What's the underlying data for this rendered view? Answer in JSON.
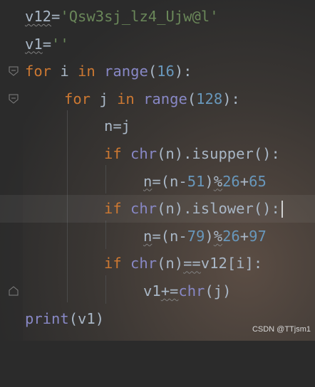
{
  "code": {
    "l1": {
      "var": "v12",
      "op": "=",
      "str": "'Qsw3sj_lz4_Ujw@l'"
    },
    "l2": {
      "var": "v1",
      "op": "=",
      "str": "''"
    },
    "l3": {
      "kw1": "for",
      "var": " i ",
      "kw2": "in",
      "sp": " ",
      "fn": "range",
      "p1": "(",
      "num": "16",
      "p2": "):"
    },
    "l4": {
      "kw1": "for",
      "var": " j ",
      "kw2": "in",
      "sp": " ",
      "fn": "range",
      "p1": "(",
      "num": "128",
      "p2": "):"
    },
    "l5": {
      "text": "n=j"
    },
    "l6": {
      "kw": "if",
      "sp": " ",
      "fn": "chr",
      "rest": "(n).isupper():"
    },
    "l7": {
      "a": "n",
      "b": "=(n-",
      "num1": "51",
      "c": ")",
      "d": "%",
      "num2": "26",
      "e": "+",
      "num3": "65"
    },
    "l8": {
      "kw": "if",
      "sp": " ",
      "fn": "chr",
      "rest": "(n).islower():"
    },
    "l9": {
      "a": "n",
      "b": "=(n-",
      "num1": "79",
      "c": ")",
      "d": "%",
      "num2": "26",
      "e": "+",
      "num3": "97"
    },
    "l10": {
      "kw": "if",
      "sp": " ",
      "fn": "chr",
      "a": "(n)",
      "b": "==",
      "c": "v12[i]:"
    },
    "l11": {
      "a": "v1",
      "b": "+=",
      "fn": "chr",
      "c": "(j)"
    },
    "l12": {
      "fn": "print",
      "rest": "(v1)"
    }
  },
  "watermark": "CSDN @TTjsm1",
  "icons": {
    "fold_open": "fold-open-icon",
    "fold_end": "fold-end-icon"
  },
  "colors": {
    "keyword": "#cc7832",
    "builtin": "#8888c6",
    "number": "#6897bb",
    "string": "#6a8759",
    "text": "#a9b7c6",
    "background": "#2b2b2b"
  }
}
